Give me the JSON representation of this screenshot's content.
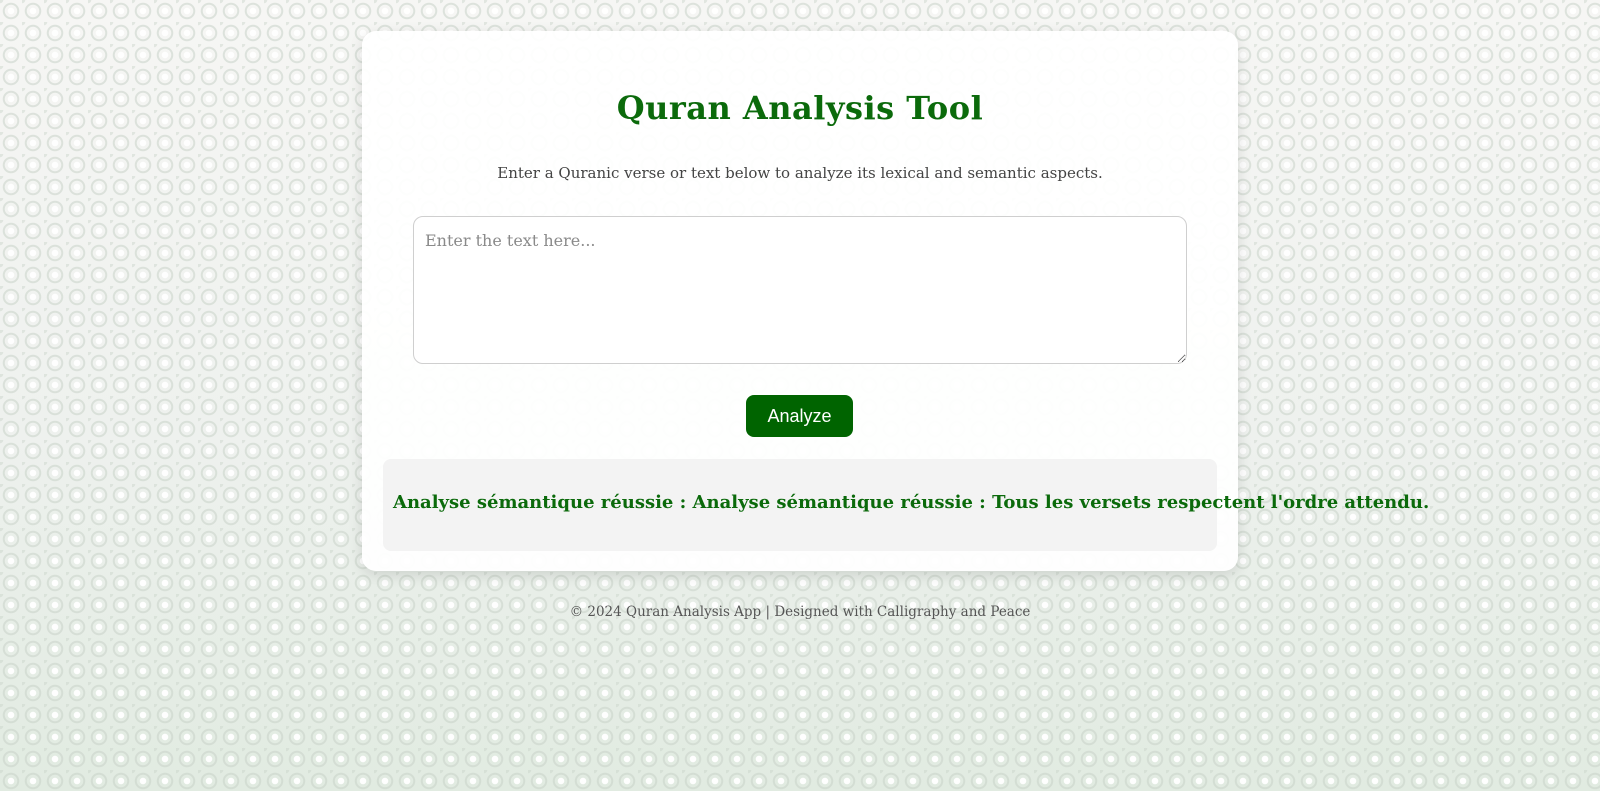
{
  "header": {
    "title": "Quran Analysis Tool",
    "subtitle": "Enter a Quranic verse or text below to analyze its lexical and semantic aspects."
  },
  "input": {
    "value": "",
    "placeholder": "Enter the text here..."
  },
  "actions": {
    "analyze_label": "Analyze"
  },
  "result": {
    "message": "Analyse sémantique réussie : Analyse sémantique réussie : Tous les versets respectent l'ordre attendu."
  },
  "footer": {
    "text": "© 2024 Quran Analysis App | Designed with Calligraphy and Peace"
  },
  "colors": {
    "accent": "#006400",
    "title": "#0b6a0b",
    "result_bg": "#f3f3f3"
  }
}
